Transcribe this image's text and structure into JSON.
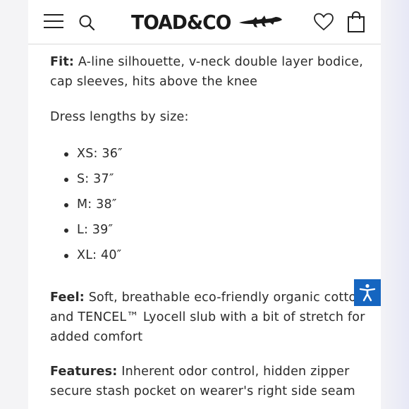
{
  "header": {
    "brand": "TOAD&CO",
    "icons": {
      "menu": "hamburger-menu-icon",
      "search": "search-icon",
      "logo_mark": "lizard-icon",
      "wishlist": "heart-icon",
      "cart": "shopping-bag-icon"
    }
  },
  "content": {
    "fit": {
      "label": "Fit:",
      "text": "A-line silhouette, v-neck double layer bodice, cap sleeves, hits above the knee"
    },
    "lengths_title": "Dress lengths by size:",
    "sizes": [
      "XS: 36″",
      "S: 37″",
      "M: 38″",
      "L: 39″",
      "XL: 40″"
    ],
    "feel": {
      "label": "Feel:",
      "text": "Soft, breathable eco-friendly organic cotton and TENCEL™ Lyocell slub with a bit of stretch for added comfort"
    },
    "features": {
      "label": "Features:",
      "text": "Inherent odor control, hidden zipper secure stash pocket on wearer's right side seam"
    }
  },
  "accessibility": {
    "icon": "accessibility-icon"
  },
  "colors": {
    "accent": "#1565c0",
    "text": "#2b2b2b",
    "divider": "#d9d9d9"
  }
}
